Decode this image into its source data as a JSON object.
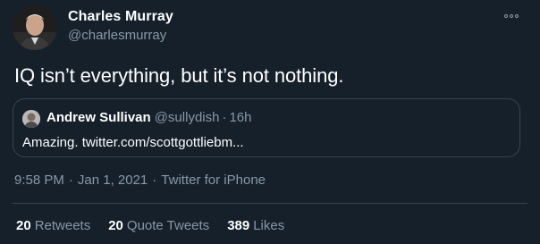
{
  "tweet": {
    "author_name": "Charles Murray",
    "author_handle": "@charlesmurray",
    "text": "IQ isn’t everything, but it’s not nothing.",
    "time": "9:58 PM",
    "date": "Jan 1, 2021",
    "source": "Twitter for iPhone",
    "meta_separator": "·"
  },
  "quote": {
    "author_name": "Andrew Sullivan",
    "author_handle": "@sullydish",
    "separator": "·",
    "time": "16h",
    "text": "Amazing. twitter.com/scottgottliebm..."
  },
  "stats": {
    "retweets_count": "20",
    "retweets_label": "Retweets",
    "quotes_count": "20",
    "quotes_label": "Quote Tweets",
    "likes_count": "389",
    "likes_label": "Likes"
  },
  "colors": {
    "background": "#15202b",
    "primary_text": "#ffffff",
    "secondary_text": "#8899a6",
    "border": "#38444d"
  },
  "icons": {
    "more": "more-horizontal-icon"
  }
}
